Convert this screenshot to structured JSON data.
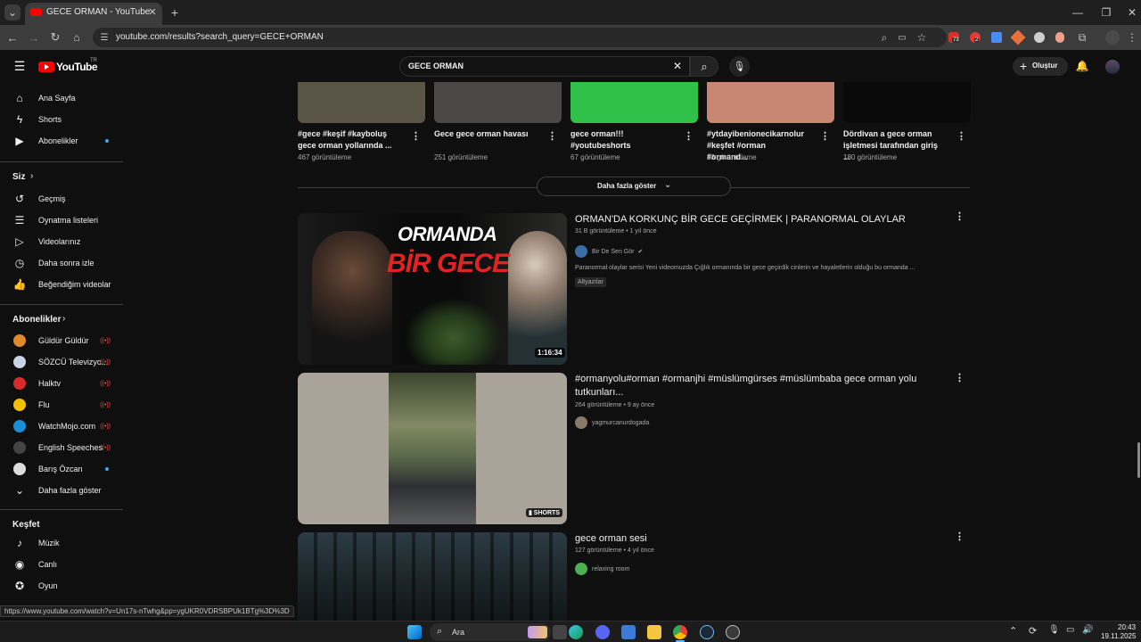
{
  "browser": {
    "tab_title": "GECE ORMAN - YouTube",
    "url": "youtube.com/results?search_query=GECE+ORMAN",
    "ext_badge_1": "73",
    "ext_badge_2": "2"
  },
  "masthead": {
    "logo_text": "YouTube",
    "logo_region": "TR",
    "search_value": "GECE ORMAN",
    "create_label": "Oluştur"
  },
  "sidebar": {
    "main": [
      {
        "label": "Ana Sayfa",
        "icon": "home-icon"
      },
      {
        "label": "Shorts",
        "icon": "shorts-icon"
      },
      {
        "label": "Abonelikler",
        "icon": "subscriptions-icon"
      }
    ],
    "you_heading": "Siz",
    "you_items": [
      {
        "label": "Geçmiş",
        "icon": "history-icon"
      },
      {
        "label": "Oynatma listeleri",
        "icon": "playlists-icon"
      },
      {
        "label": "Videolarınız",
        "icon": "your-videos-icon"
      },
      {
        "label": "Daha sonra izle",
        "icon": "watch-later-icon"
      },
      {
        "label": "Beğendiğim videolar",
        "icon": "liked-icon"
      }
    ],
    "subs_heading": "Abonelikler",
    "subs": [
      {
        "label": "Güldür Güldür",
        "color": "#e08a2c"
      },
      {
        "label": "SÖZCÜ Televizyo...",
        "color": "#c9d3e6"
      },
      {
        "label": "Halktv",
        "color": "#d92b2b"
      },
      {
        "label": "Flu",
        "color": "#f2c200"
      },
      {
        "label": "WatchMojo.com",
        "color": "#1b8fd6"
      },
      {
        "label": "English Speeches",
        "color": "#444444"
      },
      {
        "label": "Barış Özcan",
        "color": "#dddddd"
      }
    ],
    "show_more": "Daha fazla göster",
    "explore_heading": "Keşfet",
    "explore": [
      {
        "label": "Müzik",
        "icon": "music-icon"
      },
      {
        "label": "Canlı",
        "icon": "live-icon"
      },
      {
        "label": "Oyun",
        "icon": "gaming-icon"
      }
    ]
  },
  "shorts": [
    {
      "title": "#gece #keşif #kayboluş gece orman yollarında ...",
      "views": "467 görüntüleme",
      "color": "#5a5446"
    },
    {
      "title": "Gece gece orman havası",
      "views": "251 görüntüleme",
      "color": "#4a4746"
    },
    {
      "title": "gece orman!!! #youtubeshorts",
      "views": "67 görüntüleme",
      "color": "#2fc14a"
    },
    {
      "title": "#ytdayibenionecikarnolur #keşfet #orman #ormand...",
      "views": "33 görüntüleme",
      "color": "#c78773"
    },
    {
      "title": "Dördivan a   gece orman işletmesi tarafından giriş ...",
      "views": "180 görüntüleme",
      "color": "#0a0a0a"
    }
  ],
  "show_more_button": "Daha fazla göster",
  "videos": [
    {
      "title": "ORMAN'DA KORKUNÇ BİR GECE GEÇİRMEK | PARANORMAL OLAYLAR",
      "meta": "31 B görüntüleme • 1 yıl önce",
      "channel": "Bir De Sen Gör",
      "description": "Paranormal olaylar serisi Yeni videomuzda Çığlık ormanında bir gece geçirdik cinlerin ve hayaletlerin olduğu bu ormanda ...",
      "badge": "Altyazılar",
      "duration": "1:16:34",
      "thumb_text_1": "ORMANDA",
      "thumb_text_2": "BİR GECE"
    },
    {
      "title": "#ormanyolu#orman #ormanjhi #müslümgürses #müslümbaba gece orman yolu tutkunları...",
      "meta": "264 görüntüleme • 9 ay önce",
      "channel": "yagmurcanurdogada",
      "duration": "SHORTS"
    },
    {
      "title": "gece orman sesi",
      "meta": "127 görüntüleme • 4 yıl önce",
      "channel": "relaxing room"
    }
  ],
  "status_url": "https://www.youtube.com/watch?v=Un17s-nTwhg&pp=ygUKR0VDRSBPUk1BTg%3D%3D",
  "taskbar": {
    "search_label": "Ara",
    "time": "20:43",
    "date": "19.11.2025"
  }
}
